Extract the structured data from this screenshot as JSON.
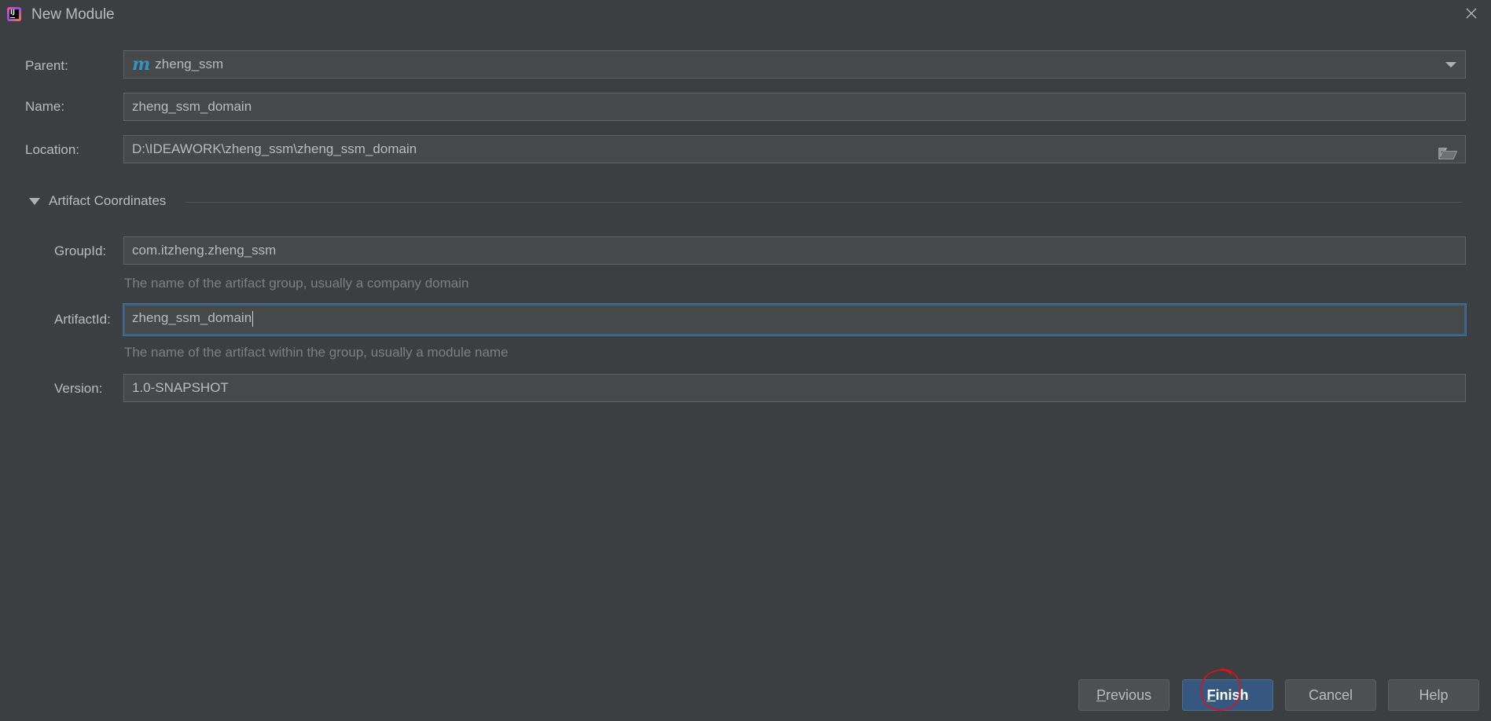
{
  "window": {
    "title": "New Module"
  },
  "form": {
    "parent": {
      "label": "Parent:",
      "value": "zheng_ssm",
      "icon": "maven-m-icon"
    },
    "name": {
      "label": "Name:",
      "value": "zheng_ssm_domain"
    },
    "location": {
      "label": "Location:",
      "value": "D:\\IDEAWORK\\zheng_ssm\\zheng_ssm_domain"
    }
  },
  "artifact": {
    "section_title": "Artifact Coordinates",
    "expanded": true,
    "group_id": {
      "label": "GroupId:",
      "value": "com.itzheng.zheng_ssm",
      "hint": "The name of the artifact group, usually a company domain"
    },
    "artifact_id": {
      "label": "ArtifactId:",
      "value": "zheng_ssm_domain",
      "hint": "The name of the artifact within the group, usually a module name",
      "focused": true
    },
    "version": {
      "label": "Version:",
      "value": "1.0-SNAPSHOT"
    }
  },
  "buttons": {
    "previous": {
      "mnemonic": "P",
      "rest": "revious"
    },
    "finish": {
      "mnemonic": "F",
      "rest": "inish",
      "highlighted": true
    },
    "cancel": {
      "label": "Cancel"
    },
    "help": {
      "label": "Help"
    }
  },
  "colors": {
    "background": "#3c3f41",
    "field_bg": "#45494a",
    "focus_border": "#3d6185",
    "primary_button": "#365880",
    "hint_text": "#7d7f81",
    "annotation_red": "#e0101a"
  }
}
